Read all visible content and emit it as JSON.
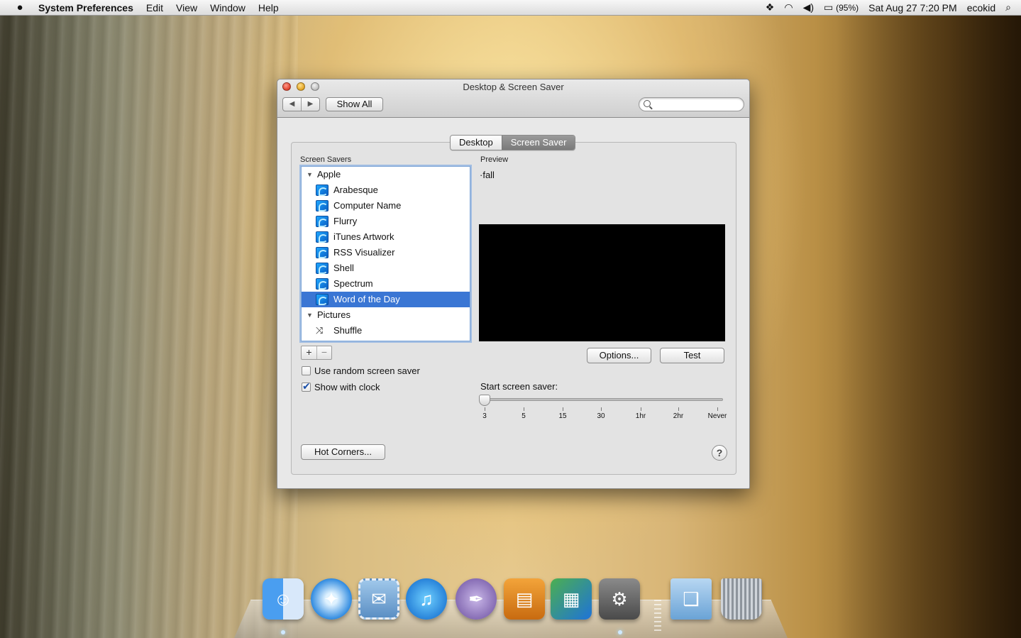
{
  "menubar": {
    "apple": "",
    "app_name": "System Preferences",
    "menus": [
      "Edit",
      "View",
      "Window",
      "Help"
    ],
    "battery": "(95%)",
    "datetime": "Sat Aug 27  7:20 PM",
    "user": "ecokid"
  },
  "window": {
    "title": "Desktop & Screen Saver",
    "show_all": "Show All",
    "search_placeholder": "",
    "tabs": [
      {
        "label": "Desktop",
        "active": false
      },
      {
        "label": "Screen Saver",
        "active": true
      }
    ],
    "screen_savers_label": "Screen Savers",
    "preview_label": "Preview",
    "list": {
      "groups": [
        {
          "name": "Apple",
          "items": [
            "Arabesque",
            "Computer Name",
            "Flurry",
            "iTunes Artwork",
            "RSS Visualizer",
            "Shell",
            "Spectrum",
            "Word of the Day"
          ]
        },
        {
          "name": "Pictures",
          "items": [
            "Shuffle"
          ]
        }
      ],
      "selected": "Word of the Day"
    },
    "plus": "+",
    "minus": "−",
    "preview_text": "·fall",
    "options_button": "Options...",
    "test_button": "Test",
    "use_random_label": "Use random screen saver",
    "use_random_checked": false,
    "show_clock_label": "Show with clock",
    "show_clock_checked": true,
    "slider_label": "Start screen saver:",
    "slider_ticks": [
      "3",
      "5",
      "15",
      "30",
      "1hr",
      "2hr",
      "Never"
    ],
    "slider_value": "3",
    "hot_corners_button": "Hot Corners...",
    "help": "?"
  },
  "dock": {
    "apps": [
      "finder",
      "safari",
      "mail",
      "itunes",
      "script-editor",
      "keynote",
      "numbers",
      "system-preferences",
      "documents-folder",
      "trash"
    ]
  },
  "colors": {
    "selection": "#3a76d4",
    "focus_ring": "#7fa6d8"
  }
}
